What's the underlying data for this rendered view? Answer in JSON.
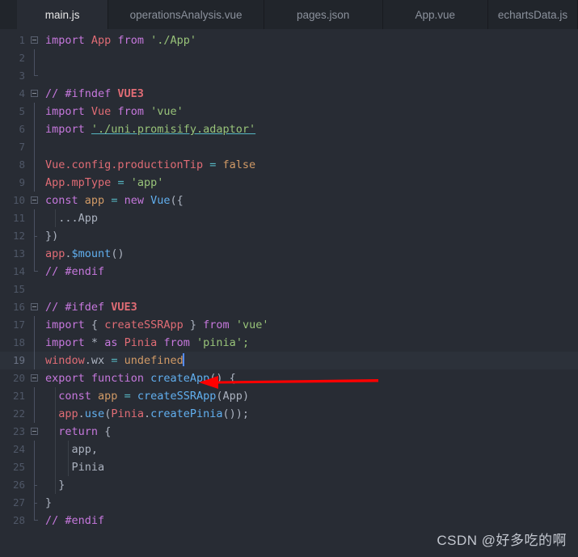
{
  "window": {
    "title": "main.js",
    "background": "#282c34"
  },
  "theme": {
    "editor_bg": "#282c34",
    "tabbar_bg": "#21252b",
    "active_tab_bg": "#282c34",
    "gutter_text": "#4f5767",
    "default_text": "#abb2bf",
    "keyword": "#c678dd",
    "variable": "#e06c75",
    "string": "#98c379",
    "function": "#61afef",
    "number": "#d19a66",
    "highlight_line": "#2c313a",
    "cursor": "#528bff",
    "annotation_arrow": "#ff0000"
  },
  "tabs": [
    {
      "label": "main.js",
      "active": true
    },
    {
      "label": "operationsAnalysis.vue",
      "active": false
    },
    {
      "label": "pages.json",
      "active": false
    },
    {
      "label": "App.vue",
      "active": false
    },
    {
      "label": "echartsData.js",
      "active": false
    }
  ],
  "code": {
    "language": "javascript",
    "total_lines": 28,
    "highlighted_line": 19,
    "cursor_line": 19,
    "cursor_column": 22,
    "lines": [
      {
        "n": "1",
        "text": "import App from './App'"
      },
      {
        "n": "2",
        "text": ""
      },
      {
        "n": "3",
        "text": ""
      },
      {
        "n": "4",
        "text": "// #ifndef VUE3"
      },
      {
        "n": "5",
        "text": "import Vue from 'vue'"
      },
      {
        "n": "6",
        "text": "import './uni.promisify.adaptor'"
      },
      {
        "n": "7",
        "text": ""
      },
      {
        "n": "8",
        "text": "Vue.config.productionTip = false"
      },
      {
        "n": "9",
        "text": "App.mpType = 'app'"
      },
      {
        "n": "10",
        "text": "const app = new Vue({"
      },
      {
        "n": "11",
        "text": "  ...App"
      },
      {
        "n": "12",
        "text": "})"
      },
      {
        "n": "13",
        "text": "app.$mount()"
      },
      {
        "n": "14",
        "text": "// #endif"
      },
      {
        "n": "15",
        "text": ""
      },
      {
        "n": "16",
        "text": "// #ifdef VUE3"
      },
      {
        "n": "17",
        "text": "import { createSSRApp } from 'vue'"
      },
      {
        "n": "18",
        "text": "import * as Pinia from 'pinia';"
      },
      {
        "n": "19",
        "text": "window.wx = undefined"
      },
      {
        "n": "20",
        "text": "export function createApp() {"
      },
      {
        "n": "21",
        "text": "  const app = createSSRApp(App)"
      },
      {
        "n": "22",
        "text": "  app.use(Pinia.createPinia());"
      },
      {
        "n": "23",
        "text": "  return {"
      },
      {
        "n": "24",
        "text": "    app,"
      },
      {
        "n": "25",
        "text": "    Pinia"
      },
      {
        "n": "26",
        "text": "  }"
      },
      {
        "n": "27",
        "text": "}"
      },
      {
        "n": "28",
        "text": "// #endif"
      }
    ]
  },
  "tokens": {
    "l1": {
      "a": "import",
      "b": "App",
      "c": "from",
      "d": "'./App'"
    },
    "l4": {
      "a": "// #ifndef",
      "b": "VUE3"
    },
    "l5": {
      "a": "import",
      "b": "Vue",
      "c": "from",
      "d": "'vue'"
    },
    "l6": {
      "a": "import",
      "b": "'./uni.promisify.adaptor'"
    },
    "l8": {
      "a": "Vue",
      "b": ".config.productionTip",
      "c": "=",
      "d": "false"
    },
    "l9": {
      "a": "App",
      "b": ".mpType",
      "c": "=",
      "d": "'app'"
    },
    "l10": {
      "a": "const",
      "b": "app",
      "c": "=",
      "d": "new",
      "e": "Vue",
      "f": "({"
    },
    "l11": {
      "a": "...App"
    },
    "l12": {
      "a": "})"
    },
    "l13": {
      "a": "app",
      "b": ".",
      "c": "$mount",
      "d": "()"
    },
    "l14": {
      "a": "// #endif"
    },
    "l16": {
      "a": "// #ifdef",
      "b": "VUE3"
    },
    "l17": {
      "a": "import",
      "b": "{",
      "c": "createSSRApp",
      "d": "}",
      "e": "from",
      "f": "'vue'"
    },
    "l18": {
      "a": "import",
      "b": "*",
      "c": "as",
      "d": "Pinia",
      "e": "from",
      "f": "'pinia';"
    },
    "l19": {
      "a": "window",
      "b": ".wx",
      "c": "=",
      "d": "undefined"
    },
    "l20": {
      "a": "export",
      "b": "function",
      "c": "createApp",
      "d": "() {"
    },
    "l21": {
      "a": "const",
      "b": "app",
      "c": "=",
      "d": "createSSRApp",
      "e": "(",
      "f": "App",
      "g": ")"
    },
    "l22": {
      "a": "app",
      "b": ".",
      "c": "use",
      "d": "(",
      "e": "Pinia",
      "f": ".",
      "g": "createPinia",
      "h": "());"
    },
    "l23": {
      "a": "return",
      "b": "{"
    },
    "l24": {
      "a": "app,"
    },
    "l25": {
      "a": "Pinia"
    },
    "l26": {
      "a": "}"
    },
    "l27": {
      "a": "}"
    },
    "l28": {
      "a": "// #endif"
    }
  },
  "annotation": {
    "type": "arrow",
    "direction": "left",
    "color": "#ff0000",
    "points_at_line": 19
  },
  "watermark": {
    "text": "CSDN @好多吃的啊"
  }
}
